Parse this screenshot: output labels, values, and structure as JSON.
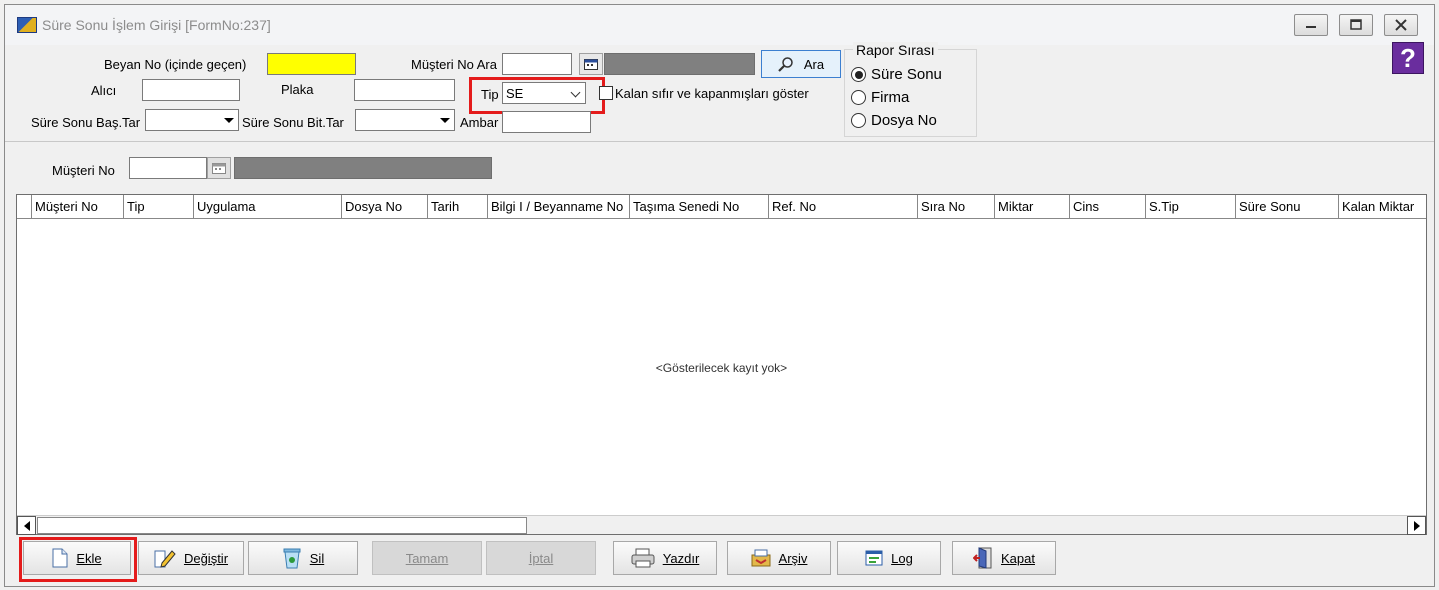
{
  "window": {
    "title": "Süre Sonu İşlem Girişi [FormNo:237]"
  },
  "help": {
    "glyph": "?"
  },
  "filters": {
    "beyan_no_label": "Beyan No (içinde geçen)",
    "beyan_no_value": "",
    "alici_label": "Alıcı",
    "alici_value": "",
    "sure_sonu_bas_label": "Süre Sonu Baş.Tar",
    "sure_sonu_bit_label": "Süre Sonu Bit.Tar",
    "plaka_label": "Plaka",
    "plaka_value": "",
    "musteri_no_ara_label": "Müşteri No Ara",
    "musteri_no_ara_value": "",
    "tip_label": "Tip",
    "tip_value": "SE",
    "kalan_label": "Kalan sıfır ve kapanmışları göster",
    "kalan_checked": false,
    "ambar_label": "Ambar",
    "ambar_value": "",
    "ara_label": "Ara",
    "musteri_no_label": "Müşteri No",
    "musteri_no_value": ""
  },
  "rapor": {
    "legend": "Rapor Sırası",
    "options": [
      "Süre Sonu",
      "Firma",
      "Dosya No"
    ],
    "selected": 0
  },
  "grid": {
    "columns": [
      "Müşteri No",
      "Tip",
      "Uygulama",
      "Dosya No",
      "Tarih",
      "Bilgi I / Beyanname No",
      "Taşıma Senedi No",
      "Ref. No",
      "Sıra No",
      "Miktar",
      "Cins",
      "S.Tip",
      "Süre Sonu",
      "Kalan Miktar"
    ],
    "empty_message": "<Gösterilecek kayıt yok>"
  },
  "toolbar": {
    "ekle": "Ekle",
    "degistir": "Değiştir",
    "sil": "Sil",
    "tamam": "Tamam",
    "iptal": "İptal",
    "yazdir": "Yazdır",
    "arsiv": "Arşiv",
    "log": "Log",
    "kapat": "Kapat"
  }
}
